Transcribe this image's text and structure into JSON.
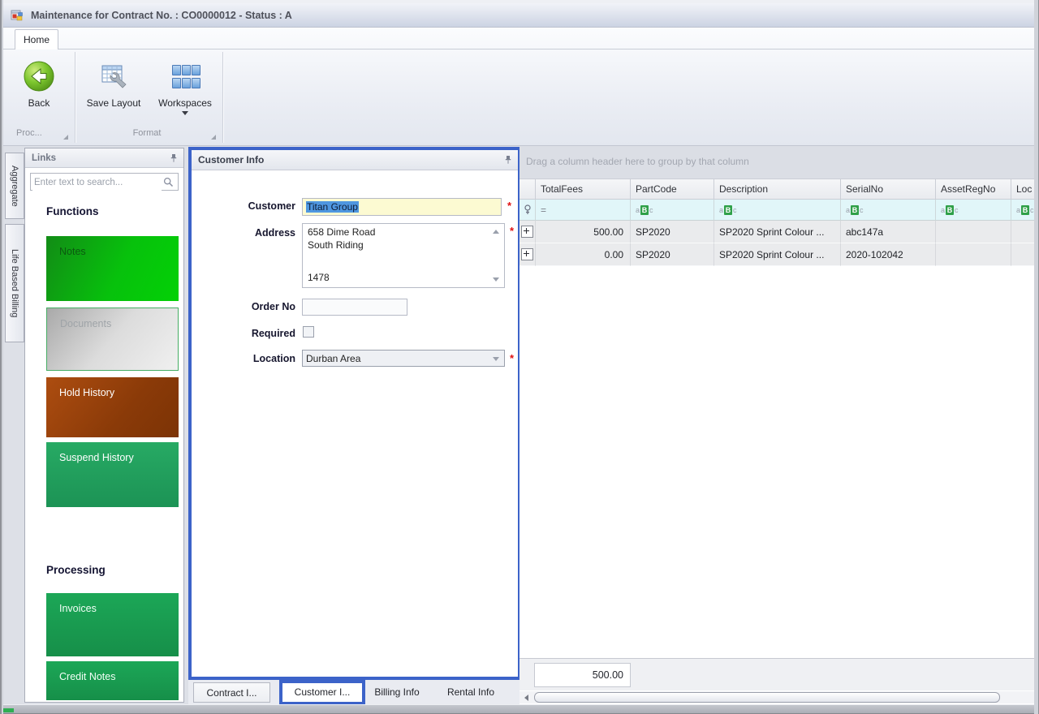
{
  "colors": {
    "accent_blue": "#3c63c9",
    "green_bright": "#07c10c",
    "green_medium": "#1ca757",
    "brown_hold": "#9a430c",
    "field_yellow": "#fcfad2",
    "filter_row_bg": "#e1f6f9"
  },
  "window": {
    "title": "Maintenance for Contract No. : CO0000012 - Status : A"
  },
  "ribbon": {
    "home_tab": "Home",
    "back_label": "Back",
    "save_layout_label": "Save Layout",
    "workspaces_label": "Workspaces",
    "group_process_label": "Proc...",
    "group_format_label": "Format"
  },
  "side_tabs": {
    "aggregate": "Aggregate",
    "life_based_billing": "Life Based Billing"
  },
  "links": {
    "title": "Links",
    "search_placeholder": "Enter text to search...",
    "functions_heading": "Functions",
    "processing_heading": "Processing",
    "notes": "Notes",
    "documents": "Documents",
    "hold_history": "Hold History",
    "suspend_history": "Suspend History",
    "invoices": "Invoices",
    "credit_notes": "Credit Notes"
  },
  "customer": {
    "panel_title": "Customer Info",
    "customer_label": "Customer",
    "customer_value": "Titan Group",
    "address_label": "Address",
    "address_line1": "658 Dime Road",
    "address_line2": "South Riding",
    "address_line3": "1478",
    "order_no_label": "Order No",
    "order_no_value": "",
    "required_label": "Required",
    "required_checked": false,
    "location_label": "Location",
    "location_value": "Durban Area",
    "required_marker": "*",
    "tabs": {
      "contract": "Contract I...",
      "customer": "Customer I...",
      "billing": "Billing Info",
      "rental": "Rental Info"
    }
  },
  "grid": {
    "group_hint": "Drag a column header here to group by that column",
    "columns": [
      "TotalFees",
      "PartCode",
      "Description",
      "SerialNo",
      "AssetRegNo",
      "Loc"
    ],
    "filter": {
      "totalfees_op": "=",
      "abc_a": "a",
      "abc_b": "B",
      "abc_c": "c"
    },
    "rows": [
      {
        "total_fees": "500.00",
        "part_code": "SP2020",
        "description": "SP2020 Sprint Colour ...",
        "serial_no": "abc147a",
        "asset_reg_no": "",
        "loc": ""
      },
      {
        "total_fees": "0.00",
        "part_code": "SP2020",
        "description": "SP2020 Sprint Colour ...",
        "serial_no": "2020-102042",
        "asset_reg_no": "",
        "loc": ""
      }
    ],
    "summary_total": "500.00"
  }
}
